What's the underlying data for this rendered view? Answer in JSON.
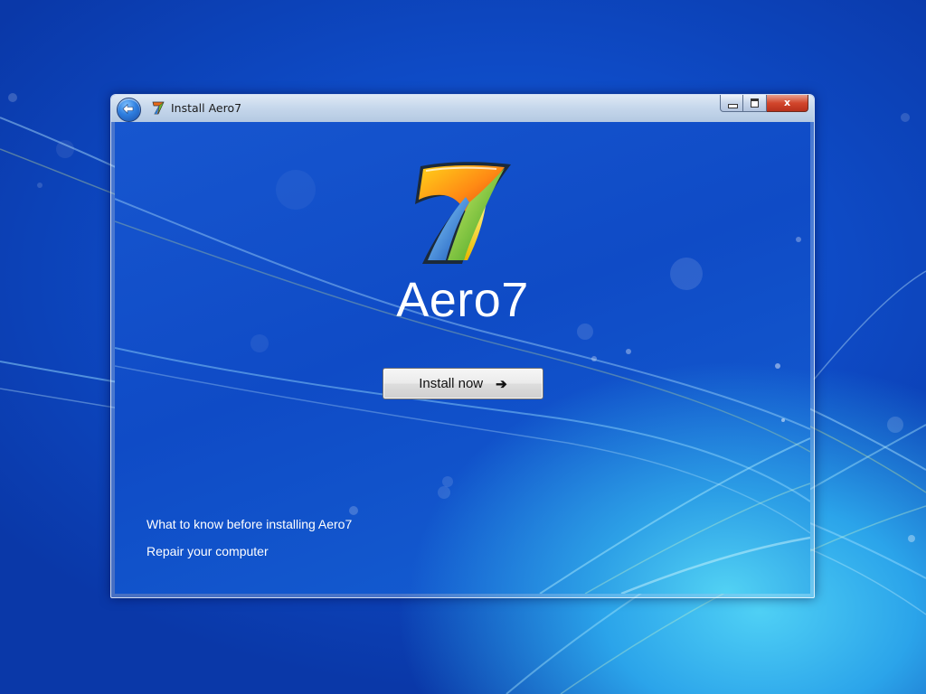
{
  "window": {
    "title": "Install Aero7",
    "caption_buttons": {
      "close_glyph": "x"
    }
  },
  "main": {
    "app_name": "Aero7",
    "install_button": {
      "label": "Install now",
      "arrow": "➔"
    },
    "links": [
      "What to know before installing Aero7",
      "Repair your computer"
    ]
  },
  "icons": {
    "back": "back-arrow-icon",
    "title": "aero7-logo-icon",
    "logo": "aero7-logo"
  },
  "colors": {
    "desktop_blue": "#0e4bc6",
    "desktop_cyan": "#4fd0f5",
    "close_red": "#d2462c",
    "titlebar": "#c7d8ec",
    "text_white": "#ffffff"
  }
}
